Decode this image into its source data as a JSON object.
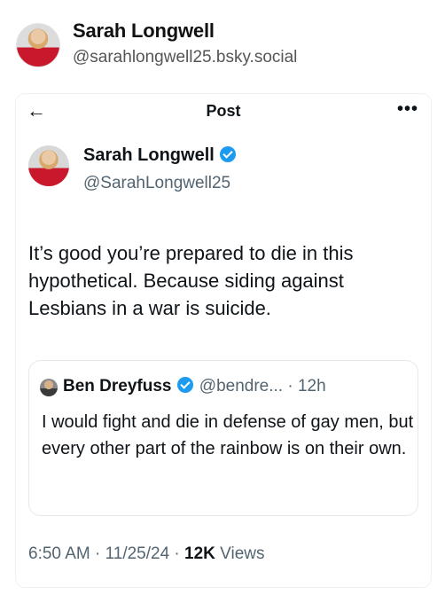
{
  "outer": {
    "name": "Sarah Longwell",
    "handle": "@sarahlongwell25.bsky.social"
  },
  "screenshot": {
    "topbar_title": "Post",
    "back_icon": "arrow-left-icon",
    "more_icon": "more-dots-icon",
    "author": {
      "name": "Sarah Longwell",
      "handle": "@SarahLongwell25",
      "verified": true
    },
    "post_text": "It’s good you’re prepared to die in this hypothetical. Because siding against Lesbians in a war is suicide.",
    "quote": {
      "name": "Ben Dreyfuss",
      "handle_time": "@bendre... · 12h",
      "verified": true,
      "text": "I would fight and die in defense of gay men, but every other part of the rainbow is on their own."
    },
    "meta": {
      "time_date": "6:50 AM · 11/25/24 · ",
      "views_count": "12K",
      "views_label": " Views"
    }
  },
  "colors": {
    "verified": "#1d9bf0",
    "secondary_text": "#536471"
  }
}
